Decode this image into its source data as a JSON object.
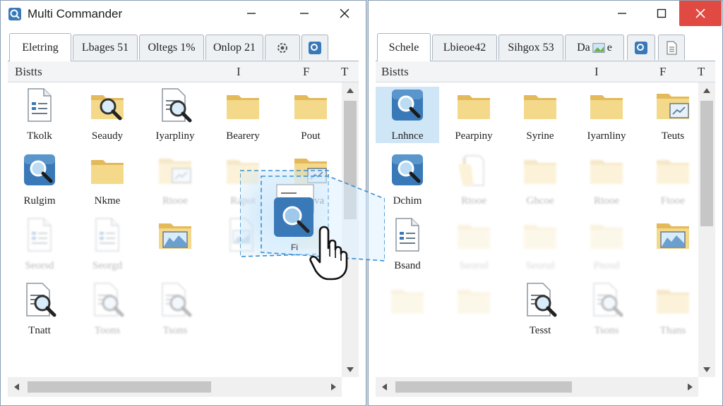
{
  "left": {
    "title": "Multi Commander",
    "tabs": [
      "Eletring",
      "Lbages 51",
      "Oltegs 1%",
      "Onlop 21"
    ],
    "columns": {
      "name": "Bistts",
      "c1": "I",
      "c2": "F",
      "c3": "T"
    },
    "files": [
      {
        "name": "Tkolk",
        "icon": "document-icon"
      },
      {
        "name": "Seaudy",
        "icon": "search-folder-icon"
      },
      {
        "name": "Iyarpliny",
        "icon": "search-document-icon"
      },
      {
        "name": "Bearery",
        "icon": "folder-icon"
      },
      {
        "name": "Pout",
        "icon": "folder-icon"
      },
      {
        "name": "Rulgim",
        "icon": "search-app-icon"
      },
      {
        "name": "Nkme",
        "icon": "folder-icon"
      },
      {
        "name": "Rtooe",
        "icon": "image-folder-icon"
      },
      {
        "name": "Rapot",
        "icon": "folder-icon"
      },
      {
        "name": "Rabva",
        "icon": "image-folder-icon"
      },
      {
        "name": "Seorsd",
        "icon": "document-icon"
      },
      {
        "name": "Seorgd",
        "icon": "document-icon"
      },
      {
        "name": "",
        "icon": "chart-folder-icon"
      },
      {
        "name": "",
        "icon": "image-document-icon"
      },
      {
        "name": "",
        "icon": "folder-icon"
      },
      {
        "name": "Tnatt",
        "icon": "search-document-icon"
      },
      {
        "name": "Toons",
        "icon": "search-document-icon"
      },
      {
        "name": "Tsons",
        "icon": "search-document-icon"
      }
    ],
    "drag_label": "Fi"
  },
  "right": {
    "tabs": [
      "Schele",
      "Lbieoe42",
      "Sihgox 53",
      "Da"
    ],
    "tab_badge": "e",
    "columns": {
      "name": "Bistts",
      "c1": "I",
      "c2": "F",
      "c3": "T"
    },
    "files": [
      {
        "name": "Lnhnce",
        "icon": "search-app-icon"
      },
      {
        "name": "Pearpiny",
        "icon": "folder-icon"
      },
      {
        "name": "Syrine",
        "icon": "folder-icon"
      },
      {
        "name": "Iyarnliny",
        "icon": "folder-icon"
      },
      {
        "name": "Teuts",
        "icon": "image-folder-icon"
      },
      {
        "name": "Dchim",
        "icon": "search-app-icon"
      },
      {
        "name": "Rtooe",
        "icon": "document-folder-icon"
      },
      {
        "name": "Ghcoe",
        "icon": "folder-icon"
      },
      {
        "name": "Rtooe",
        "icon": "folder-icon"
      },
      {
        "name": "Ftooe",
        "icon": "folder-icon"
      },
      {
        "name": "Bsand",
        "icon": "document-icon"
      },
      {
        "name": "Seorsd",
        "icon": "folder-icon"
      },
      {
        "name": "Seorsd",
        "icon": "folder-icon"
      },
      {
        "name": "Pnosd",
        "icon": "folder-icon"
      },
      {
        "name": "",
        "icon": "chart-folder-icon"
      },
      {
        "name": "",
        "icon": "folder-icon"
      },
      {
        "name": "",
        "icon": "folder-icon"
      },
      {
        "name": "Tesst",
        "icon": "search-document-icon"
      },
      {
        "name": "Tsons",
        "icon": "search-document-icon"
      },
      {
        "name": "Thans",
        "icon": "folder-icon"
      }
    ]
  },
  "colors": {
    "accent": "#3a79b8",
    "selection": "#cfe6f7",
    "close": "#e04a43",
    "folder": "#f0cf7c"
  }
}
